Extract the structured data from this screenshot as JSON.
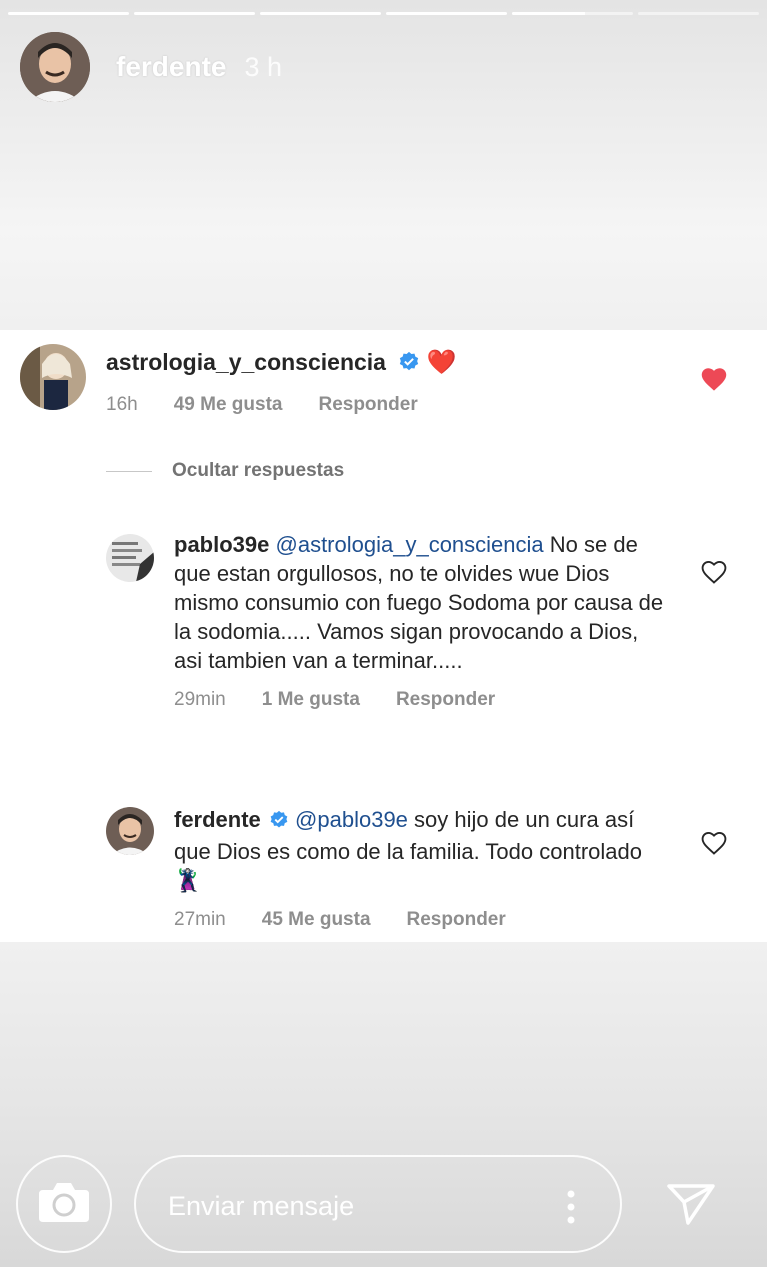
{
  "story": {
    "progress": [
      1,
      1,
      1,
      1,
      0.6,
      0
    ],
    "username": "ferdente",
    "time": "3 h"
  },
  "thread": {
    "root": {
      "username": "astrologia_y_consciencia",
      "emoji": "❤️",
      "time": "16h",
      "likes": "49 Me gusta",
      "reply_label": "Responder",
      "liked": true
    },
    "hide_replies": "Ocultar respuestas",
    "replies": [
      {
        "username": "pablo39e",
        "mention": "@astrologia_y_consciencia",
        "text": "No se de que estan orgullosos, no te olvides wue Dios mismo consumio con fuego Sodoma por causa de la sodomia..... Vamos sigan provocando a Dios, asi tambien van a terminar.....",
        "time": "29min",
        "likes": "1 Me gusta",
        "reply_label": "Responder"
      },
      {
        "username": "ferdente",
        "mention": "@pablo39e",
        "text": "soy hijo de un cura así que Dios es como de la familia. Todo controlado",
        "emoji": "🦹",
        "time": "27min",
        "likes": "45 Me gusta",
        "reply_label": "Responder"
      }
    ]
  },
  "composer": {
    "placeholder": "Enviar mensaje"
  },
  "icons": {
    "camera": "camera-icon",
    "more": "more-options-icon",
    "send": "send-icon",
    "heart": "heart-icon",
    "verified": "verified-badge-icon"
  },
  "colors": {
    "like_red": "#ed4956",
    "verified_blue": "#3897f0",
    "mention_blue": "#1f4f8f"
  }
}
